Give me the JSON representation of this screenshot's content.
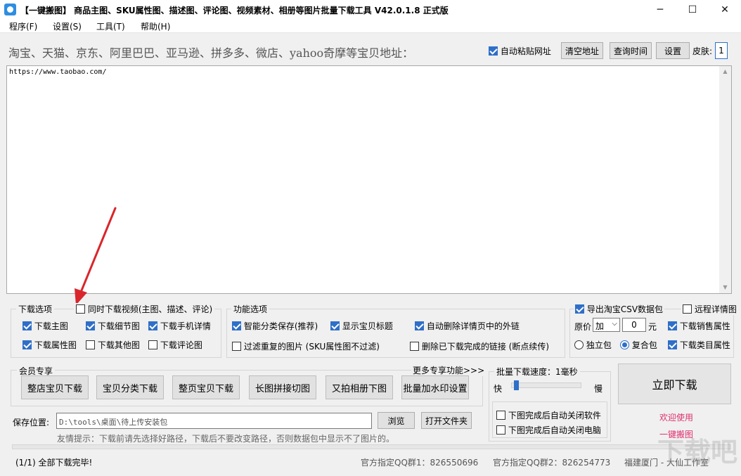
{
  "window": {
    "title": "【一键搬图】 商品主图、SKU属性图、描述图、评论图、视频素材、相册等图片批量下载工具 V42.0.1.8 正式版",
    "minimize": "─",
    "maximize": "☐",
    "close": "✕"
  },
  "menu": [
    "程序(F)",
    "设置(S)",
    "工具(T)",
    "帮助(H)"
  ],
  "address": {
    "label": "淘宝、天猫、京东、阿里巴巴、亚马逊、拼多多、微店、yahoo奇摩等宝贝地址：",
    "auto_paste": "自动粘贴网址",
    "clear_btn": "清空地址",
    "query_time_btn": "查询时间",
    "settings_btn": "设置",
    "skin_label": "皮肤:",
    "skin_value": "1",
    "url_value": "https://www.taobao.com/"
  },
  "download_options": {
    "title": "下载选项",
    "video": "同时下载视频(主图、描述、评论)",
    "main_img": "下载主图",
    "detail_img": "下载细节图",
    "mobile_detail": "下载手机详情",
    "attr_img": "下载属性图",
    "other_img": "下载其他图",
    "review_img": "下载评论图"
  },
  "function_options": {
    "title": "功能选项",
    "smart_save": "智能分类保存(推荐)",
    "show_title": "显示宝贝标题",
    "auto_delete_links": "自动删除详情页中的外链",
    "filter_dup": "过滤重复的图片 (SKU属性图不过滤)",
    "delete_done_links": "删除已下载完成的链接 (断点续传)"
  },
  "csv": {
    "export": "导出淘宝CSV数据包",
    "remote_detail": "远程详情图",
    "price_label": "原价",
    "price_op": "加",
    "price_value": "0",
    "unit": "元",
    "sales_attr": "下载销售属性",
    "single_pkg": "独立包",
    "combined_pkg": "复合包",
    "category_attr": "下载类目属性"
  },
  "member": {
    "title": "会员专享",
    "more": "更多专享功能>>>",
    "buttons": [
      "整店宝贝下载",
      "宝贝分类下载",
      "整页宝贝下载",
      "长图拼接切图",
      "又拍相册下图",
      "批量加水印设置"
    ]
  },
  "speed": {
    "title": "批量下载速度：1毫秒",
    "fast": "快",
    "slow": "慢",
    "level": 0.03,
    "close_app": "下图完成后自动关闭软件",
    "shutdown": "下图完成后自动关闭电脑"
  },
  "download_now": "立即下载",
  "welcome": "欢迎使用",
  "brand": "一键搬图",
  "save": {
    "label": "保存位置:",
    "path": "D:\\tools\\桌面\\待上传安装包",
    "browse": "浏览",
    "open_folder": "打开文件夹",
    "tip": "友情提示：下载前请先选择好路径，下载后不要改变路径，否则数据包中显示不了图片的。"
  },
  "status": {
    "progress": "(1/1) 全部下载完毕!",
    "qq1_label": "官方指定QQ群1：",
    "qq1": "826550696",
    "qq2_label": "官方指定QQ群2：",
    "qq2": "826254773",
    "company": "福建厦门 - 大仙工作室"
  },
  "watermark": "下载吧",
  "colors": {
    "accent": "#2f6fc8",
    "arrow": "#d9262c",
    "welcome": "#e0306e"
  }
}
